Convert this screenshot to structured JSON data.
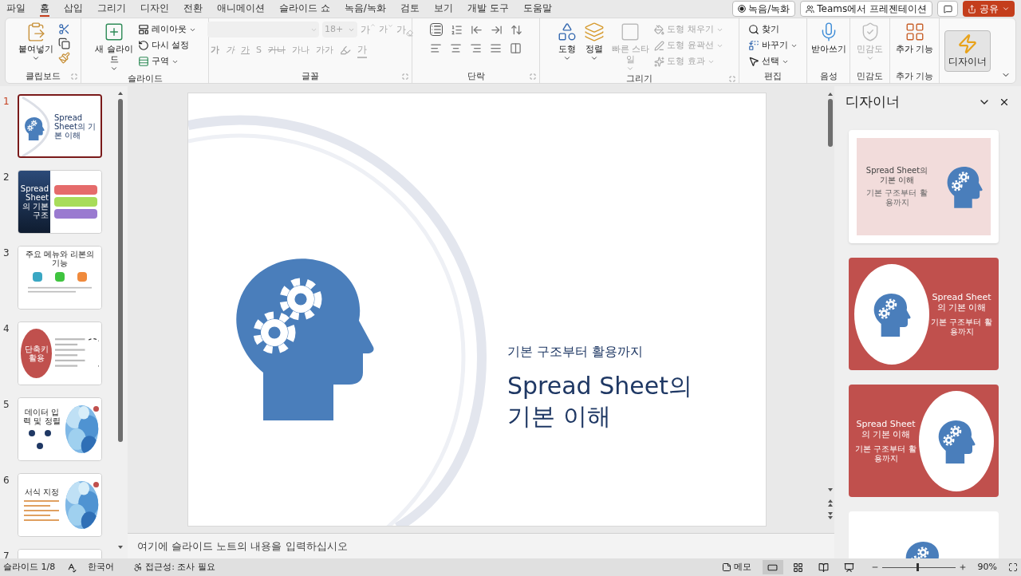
{
  "tabs": [
    {
      "label": "파일",
      "selected": false
    },
    {
      "label": "홈",
      "selected": true
    },
    {
      "label": "삽입",
      "selected": false
    },
    {
      "label": "그리기",
      "selected": false
    },
    {
      "label": "디자인",
      "selected": false
    },
    {
      "label": "전환",
      "selected": false
    },
    {
      "label": "애니메이션",
      "selected": false
    },
    {
      "label": "슬라이드 쇼",
      "selected": false
    },
    {
      "label": "녹음/녹화",
      "selected": false
    },
    {
      "label": "검토",
      "selected": false
    },
    {
      "label": "보기",
      "selected": false
    },
    {
      "label": "개발 도구",
      "selected": false
    },
    {
      "label": "도움말",
      "selected": false
    }
  ],
  "title_buttons": [
    {
      "kind": "record",
      "label": "녹음/녹화"
    },
    {
      "kind": "teams",
      "label": "Teams에서 프레젠테이션"
    },
    {
      "kind": "comment"
    },
    {
      "kind": "share",
      "label": "공유"
    }
  ],
  "ribbon": {
    "clipboard": {
      "label": "클립보드",
      "paste": "붙여넣기"
    },
    "slides": {
      "label": "슬라이드",
      "new_slide": "새 슬라이드",
      "layout": "레이아웃",
      "reset": "다시 설정",
      "section": "구역"
    },
    "font": {
      "label": "글꼴",
      "disabled": true,
      "size": "18+",
      "grow": "가",
      "shrink": "가",
      "clear": "가",
      "format_buttons": [
        {
          "kind": "bold",
          "label": "가"
        },
        {
          "kind": "italic",
          "label": "가"
        },
        {
          "kind": "underline",
          "label": "가"
        },
        {
          "kind": "shadow",
          "label": "S"
        },
        {
          "kind": "strike",
          "label": "가나"
        },
        {
          "kind": "spacing",
          "label": "가나"
        },
        {
          "kind": "case",
          "label": "가가"
        }
      ],
      "font_color": "가"
    },
    "paragraph": {
      "label": "단락"
    },
    "drawing": {
      "label": "그리기",
      "shape": "도형",
      "arrange": "정렬",
      "quick_styles": {
        "label": "빠른 스타일",
        "disabled": true
      },
      "options": [
        {
          "kind": "fill",
          "label": "도형 채우기",
          "disabled": true
        },
        {
          "kind": "outline",
          "label": "도형 윤곽선",
          "disabled": true
        },
        {
          "kind": "effects",
          "label": "도형 효과",
          "disabled": true
        }
      ]
    },
    "editing": {
      "label": "편집",
      "find": "찾기",
      "replace": "바꾸기",
      "select": "선택"
    },
    "voice": {
      "label": "음성",
      "dictate": "받아쓰기"
    },
    "sensitivity": {
      "label": "민감도",
      "button": "민감도",
      "disabled": true
    },
    "addins": {
      "label": "추가 기능",
      "button": "추가 기능"
    },
    "designer": {
      "button": "디자이너",
      "selected": true
    }
  },
  "slides": [
    {
      "number": "1",
      "kind": "title",
      "title": "Spread Sheet의 기본 이해",
      "selected": true
    },
    {
      "number": "2",
      "kind": "split",
      "title": "Spread Sheet의 기본 구조",
      "selected": false
    },
    {
      "number": "3",
      "kind": "icons",
      "title": "주요 메뉴와 리본의 기능",
      "selected": false
    },
    {
      "number": "4",
      "kind": "circle",
      "title": "단축키 활용",
      "selected": false
    },
    {
      "number": "5",
      "title": "데이터 입력 및 정렬",
      "selected": false
    },
    {
      "number": "6",
      "kind": "photo_list",
      "title": "서식 지정",
      "selected": false
    },
    {
      "number": "7",
      "kind": "partial",
      "selected": false
    }
  ],
  "slide": {
    "subtitle": "기본 구조부터 활용까지",
    "title_lines": [
      "Spread Sheet의",
      "기본 이해"
    ]
  },
  "notes": {
    "placeholder": "여기에 슬라이드 노트의 내용을 입력하십시오"
  },
  "designer": {
    "title": "디자이너",
    "designs": [
      {
        "kind": "pink",
        "title": "Spread Sheet의 기본 이해",
        "subtitle": "기본 구조부터 활용까지"
      },
      {
        "kind": "red_left",
        "title": "Spread Sheet의 기본 이해",
        "subtitle": "기본 구조부터 활용까지"
      },
      {
        "kind": "red_right",
        "title": "Spread Sheet의 기본 이해",
        "subtitle": "기본 구조부터 활용까지"
      },
      {
        "kind": "partial"
      }
    ]
  },
  "status_bar": {
    "slide_count": "슬라이드 1/8",
    "language": "한국어",
    "accessibility": "접근성: 조사 필요",
    "notes": "메모",
    "views": [
      {
        "kind": "normal",
        "selected": true
      },
      {
        "kind": "sorter",
        "selected": false
      },
      {
        "kind": "reading",
        "selected": false
      },
      {
        "kind": "show",
        "selected": false
      }
    ],
    "zoom": {
      "label": "90%",
      "level": 0.47
    }
  }
}
